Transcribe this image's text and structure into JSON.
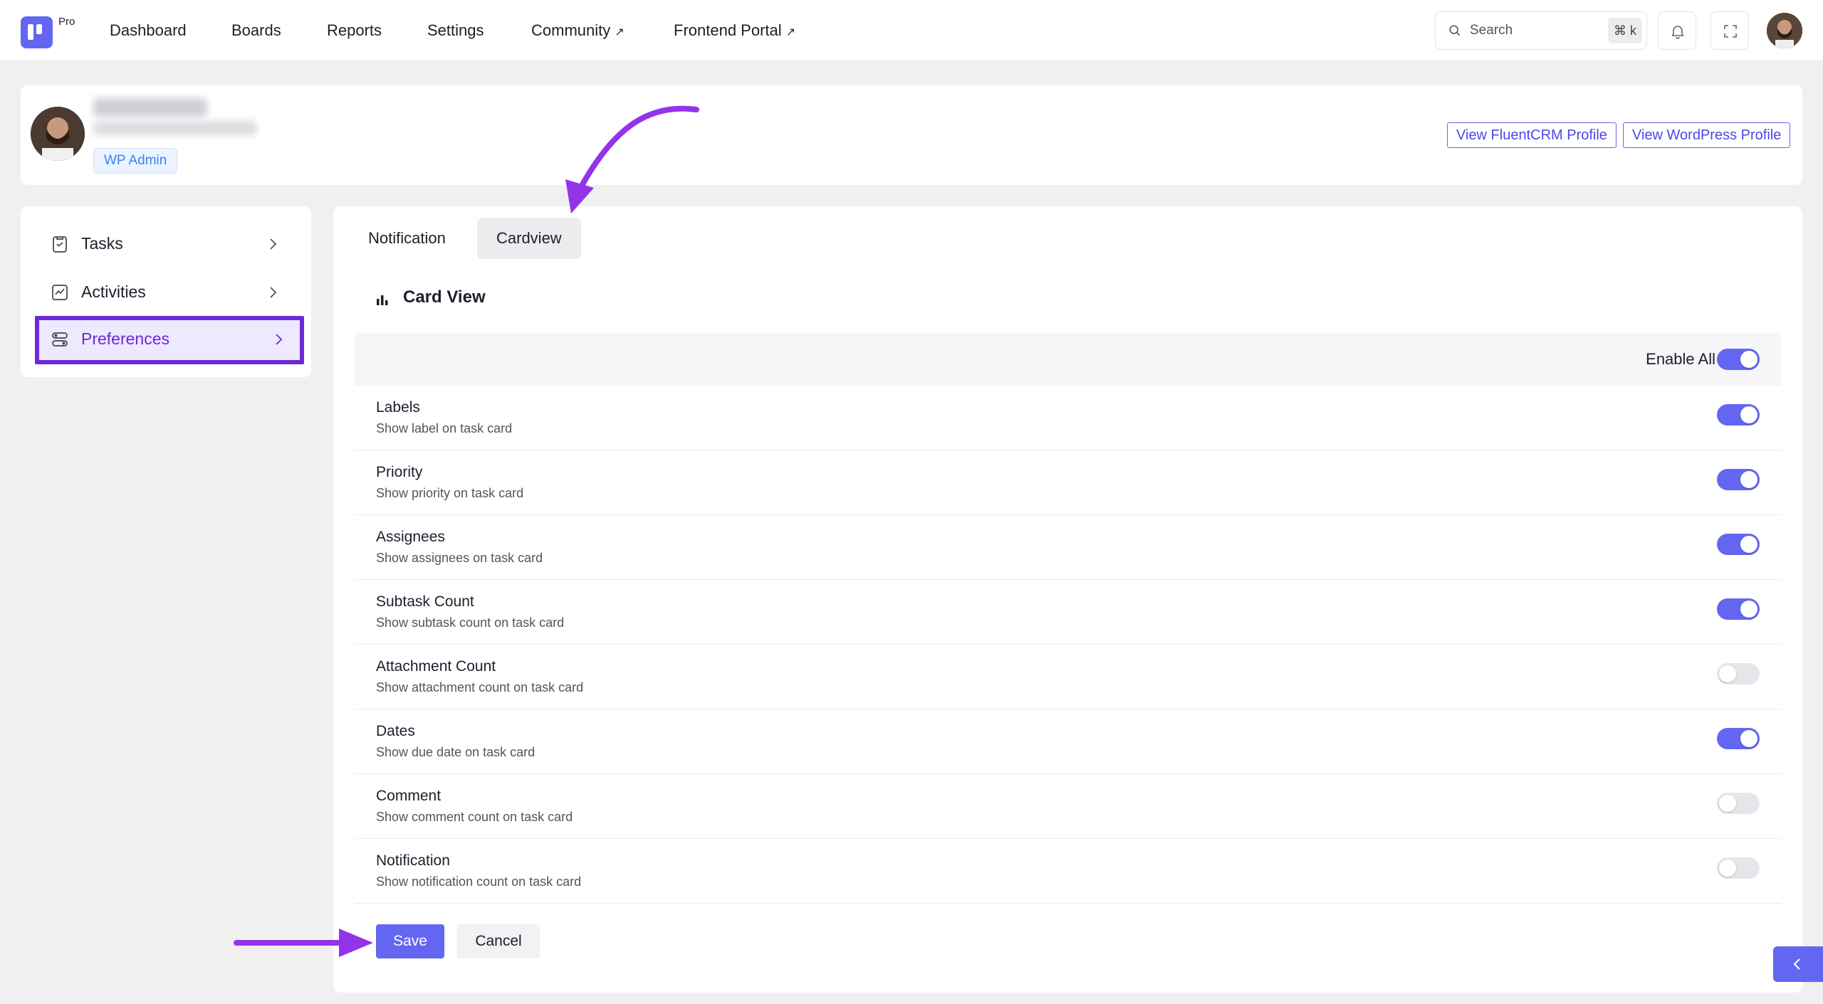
{
  "app": {
    "badge": "Pro",
    "nav": [
      {
        "label": "Dashboard",
        "external": false
      },
      {
        "label": "Boards",
        "external": false
      },
      {
        "label": "Reports",
        "external": false
      },
      {
        "label": "Settings",
        "external": false
      },
      {
        "label": "Community",
        "external": true
      },
      {
        "label": "Frontend Portal",
        "external": true
      }
    ],
    "external_glyph": "↗",
    "search": {
      "placeholder": "Search",
      "shortcut": "⌘ k"
    },
    "icons": [
      "search-icon",
      "bell-icon",
      "fullscreen-icon"
    ]
  },
  "profile": {
    "role_badge": "WP Admin",
    "fluentcrm_button": "View FluentCRM Profile",
    "wordpress_button": "View WordPress Profile"
  },
  "sidebar": {
    "items": [
      {
        "label": "Tasks",
        "icon": "tasks-icon",
        "active": false
      },
      {
        "label": "Activities",
        "icon": "activity-icon",
        "active": false
      },
      {
        "label": "Preferences",
        "icon": "preferences-icon",
        "active": true
      }
    ]
  },
  "main": {
    "tabs": [
      {
        "label": "Notification",
        "active": false
      },
      {
        "label": "Cardview",
        "active": true
      }
    ],
    "section_title": "Card View",
    "enable_all": {
      "label": "Enable All",
      "on": true
    },
    "preferences": [
      {
        "title": "Labels",
        "description": "Show label on task card",
        "on": true
      },
      {
        "title": "Priority",
        "description": "Show priority on task card",
        "on": true
      },
      {
        "title": "Assignees",
        "description": "Show assignees on task card",
        "on": true
      },
      {
        "title": "Subtask Count",
        "description": "Show subtask count on task card",
        "on": true
      },
      {
        "title": "Attachment Count",
        "description": "Show attachment count on task card",
        "on": false
      },
      {
        "title": "Dates",
        "description": "Show due date on task card",
        "on": true
      },
      {
        "title": "Comment",
        "description": "Show comment count on task card",
        "on": false
      },
      {
        "title": "Notification",
        "description": "Show notification count on task card",
        "on": false
      }
    ],
    "save_label": "Save",
    "cancel_label": "Cancel"
  },
  "colors": {
    "accent": "#6366f1",
    "highlight_border": "#6d28d9",
    "annotation_arrow": "#9333ea"
  }
}
